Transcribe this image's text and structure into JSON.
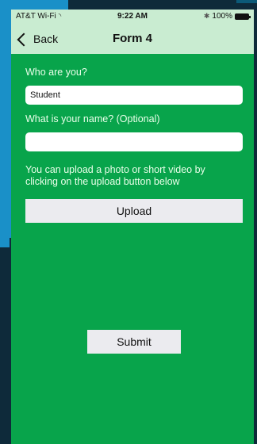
{
  "status_bar": {
    "carrier": "AT&T Wi-Fi",
    "wifi_icon": "wifi-icon",
    "time": "9:22 AM",
    "bluetooth_icon": "bluetooth-icon",
    "battery": "100%"
  },
  "nav": {
    "back_label": "Back",
    "title": "Form 4"
  },
  "form": {
    "who_label": "Who are you?",
    "who_value": "Student",
    "name_label": "What is your name? (Optional)",
    "name_value": "",
    "upload_hint": "You can upload a photo or short video by clicking on the upload button below",
    "upload_label": "Upload",
    "submit_label": "Submit"
  },
  "colors": {
    "app_background": "#08a44b",
    "bar_background": "#c9ecd1",
    "button_background": "#ebebef",
    "page_background": "#0e2a3a",
    "accent_blue": "#1a90c8"
  }
}
